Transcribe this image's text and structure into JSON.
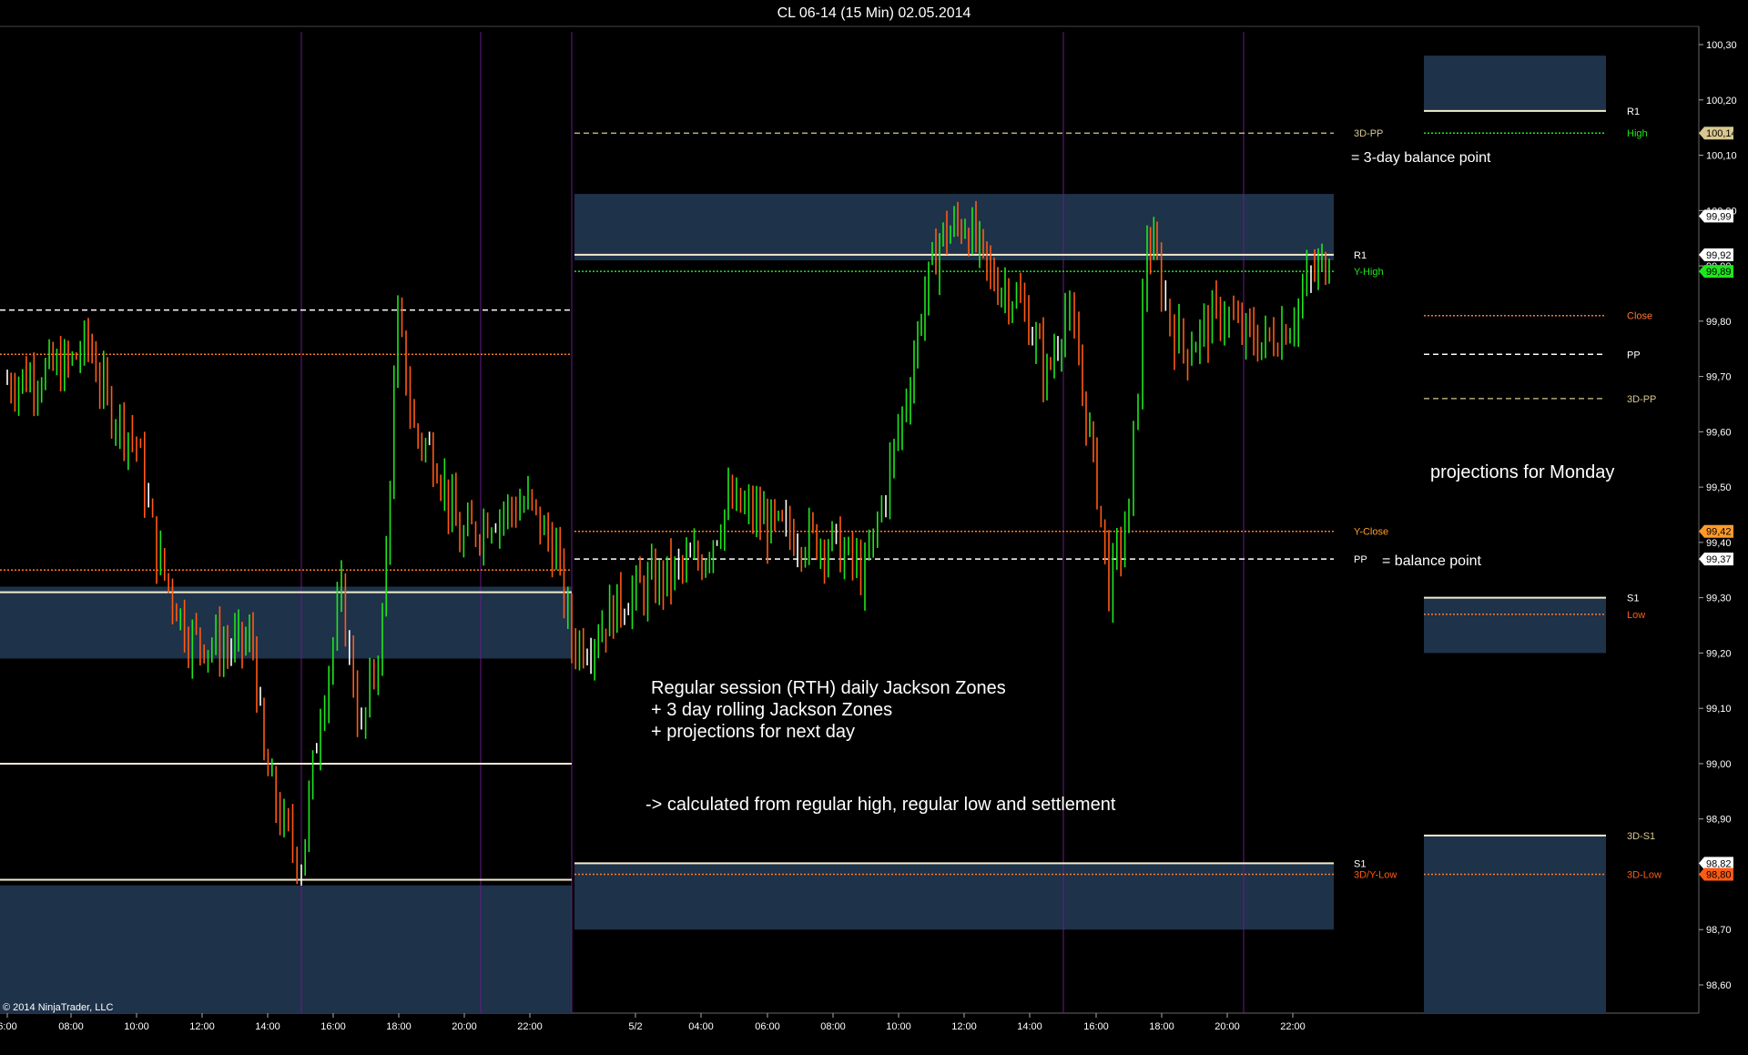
{
  "title": "CL 06-14 (15 Min)  02.05.2014",
  "copyright": "© 2014 NinjaTrader, LLC",
  "colors": {
    "background": "#000000",
    "zone_fill": "#1e3249",
    "bull": "#1ee61e",
    "bear": "#ff5a14",
    "doji": "#ffffff",
    "session_divider": "#7a1f9a",
    "pivot_line": "#f2eccf",
    "dotted_orange": "#ff7a2a",
    "dotted_green": "#1ee61e",
    "dashed_tan": "#d8c890",
    "dashed_white": "#ffffff"
  },
  "chart_data": {
    "type": "candlestick",
    "instrument": "CL 06-14",
    "interval": "15 Min",
    "date": "02.05.2014",
    "ylim": [
      98.53,
      100.33
    ],
    "yticks": [
      "100,30",
      "100,20",
      "100,10",
      "100,00",
      "99,90",
      "99,80",
      "99,70",
      "99,60",
      "99,50",
      "99,40",
      "99,30",
      "99,20",
      "99,10",
      "99,00",
      "98,90",
      "98,80",
      "98,70",
      "98,60"
    ],
    "xticks": [
      "6:00",
      "08:00",
      "10:00",
      "12:00",
      "14:00",
      "16:00",
      "18:00",
      "20:00",
      "22:00",
      "5/2",
      "04:00",
      "06:00",
      "08:00",
      "10:00",
      "12:00",
      "14:00",
      "16:00",
      "18:00",
      "20:00",
      "22:00"
    ],
    "price_badges": [
      {
        "value": 100.14,
        "text": "100,14",
        "color": "#d8c890"
      },
      {
        "value": 99.99,
        "text": "99,99",
        "color": "#ffffff"
      },
      {
        "value": 99.92,
        "text": "99,92",
        "color": "#ffffff"
      },
      {
        "value": 99.89,
        "text": "99,89",
        "color": "#1ee61e"
      },
      {
        "value": 99.42,
        "text": "99,42",
        "color": "#ff9a2a"
      },
      {
        "value": 99.37,
        "text": "99,37",
        "color": "#ffffff"
      },
      {
        "value": 98.82,
        "text": "98,82",
        "color": "#ffffff"
      },
      {
        "value": 98.8,
        "text": "98,80",
        "color": "#ff5a14"
      }
    ],
    "zones": [
      {
        "name": "day1-upper",
        "y1": 99.32,
        "y2": 99.19
      },
      {
        "name": "day1-lower",
        "y1": 98.78,
        "y2": 98.53
      },
      {
        "name": "day2-upper",
        "y1": 100.03,
        "y2": 99.91
      },
      {
        "name": "day2-lower",
        "y1": 98.82,
        "y2": 98.7
      },
      {
        "name": "proj-upper",
        "y1": 100.28,
        "y2": 100.18
      },
      {
        "name": "proj-s1",
        "y1": 99.3,
        "y2": 99.2
      },
      {
        "name": "proj-lower",
        "y1": 98.87,
        "y2": 98.53
      }
    ],
    "levels": [
      {
        "segment": "day1",
        "value": 99.82,
        "style": "dashed-white",
        "label": ""
      },
      {
        "segment": "day1",
        "value": 99.74,
        "style": "dotted-orange",
        "label": ""
      },
      {
        "segment": "day1",
        "value": 99.35,
        "style": "dotted-orange",
        "label": ""
      },
      {
        "segment": "day1",
        "value": 99.31,
        "style": "solid",
        "label": ""
      },
      {
        "segment": "day1",
        "value": 99.0,
        "style": "solid",
        "label": ""
      },
      {
        "segment": "day1",
        "value": 98.79,
        "style": "solid",
        "label": ""
      },
      {
        "segment": "day2",
        "value": 100.14,
        "style": "dashed-tan",
        "label": "3D-PP",
        "label_color": "#d8c890"
      },
      {
        "segment": "day2",
        "value": 99.92,
        "style": "solid",
        "label": "R1",
        "label_color": "#ffffff"
      },
      {
        "segment": "day2",
        "value": 99.89,
        "style": "dotted-green",
        "label": "Y-High",
        "label_color": "#1ee61e"
      },
      {
        "segment": "day2",
        "value": 99.42,
        "style": "dotted-orange",
        "label": "Y-Close",
        "label_color": "#ff9a2a"
      },
      {
        "segment": "day2",
        "value": 99.37,
        "style": "dashed-white",
        "label": "PP",
        "label_color": "#ffffff"
      },
      {
        "segment": "day2",
        "value": 98.82,
        "style": "solid",
        "label": "S1",
        "label_color": "#ffffff"
      },
      {
        "segment": "day2",
        "value": 98.8,
        "style": "dotted-orange",
        "label": "3D/Y-Low",
        "label_color": "#ff5a14"
      },
      {
        "segment": "proj",
        "value": 100.18,
        "style": "solid",
        "label": "R1",
        "label_color": "#ffffff"
      },
      {
        "segment": "proj",
        "value": 100.14,
        "style": "dotted-green",
        "label": "High",
        "label_color": "#1ee61e"
      },
      {
        "segment": "proj",
        "value": 99.81,
        "style": "dotted-orange",
        "label": "Close",
        "label_color": "#ff7a2a"
      },
      {
        "segment": "proj",
        "value": 99.74,
        "style": "dashed-white",
        "label": "PP",
        "label_color": "#ffffff"
      },
      {
        "segment": "proj",
        "value": 99.66,
        "style": "dashed-tan",
        "label": "3D-PP",
        "label_color": "#d8c890"
      },
      {
        "segment": "proj",
        "value": 99.3,
        "style": "solid",
        "label": "S1",
        "label_color": "#ffffff"
      },
      {
        "segment": "proj",
        "value": 99.27,
        "style": "dotted-orange",
        "label": "Low",
        "label_color": "#ff5a14"
      },
      {
        "segment": "proj",
        "value": 98.87,
        "style": "solid",
        "label": "3D-S1",
        "label_color": "#d8c890"
      },
      {
        "segment": "proj",
        "value": 98.8,
        "style": "dotted-orange",
        "label": "3D-Low",
        "label_color": "#ff5a14"
      }
    ],
    "close_path": [
      {
        "t": "6:00",
        "v": 99.69
      },
      {
        "t": "08:00",
        "v": 99.72
      },
      {
        "t": "08:30",
        "v": 99.76
      },
      {
        "t": "09:00",
        "v": 99.65
      },
      {
        "t": "10:00",
        "v": 99.58
      },
      {
        "t": "10:40",
        "v": 99.38
      },
      {
        "t": "11:30",
        "v": 99.23
      },
      {
        "t": "12:30",
        "v": 99.21
      },
      {
        "t": "13:30",
        "v": 99.22
      },
      {
        "t": "14:00",
        "v": 99.0
      },
      {
        "t": "14:40",
        "v": 98.88
      },
      {
        "t": "15:00",
        "v": 98.82
      },
      {
        "t": "15:30",
        "v": 99.1
      },
      {
        "t": "16:00",
        "v": 99.3
      },
      {
        "t": "16:40",
        "v": 99.05
      },
      {
        "t": "17:20",
        "v": 99.25
      },
      {
        "t": "17:50",
        "v": 99.8
      },
      {
        "t": "18:20",
        "v": 99.6
      },
      {
        "t": "19:00",
        "v": 99.55
      },
      {
        "t": "19:40",
        "v": 99.4
      },
      {
        "t": "20:30",
        "v": 99.45
      },
      {
        "t": "21:30",
        "v": 99.47
      },
      {
        "t": "22:30",
        "v": 99.38
      },
      {
        "t": "23:00",
        "v": 99.22
      },
      {
        "t": "5/2",
        "v": 99.22
      },
      {
        "t": "02:00",
        "v": 99.3
      },
      {
        "t": "04:00",
        "v": 99.37
      },
      {
        "t": "05:00",
        "v": 99.47
      },
      {
        "t": "06:00",
        "v": 99.45
      },
      {
        "t": "07:00",
        "v": 99.42
      },
      {
        "t": "08:00",
        "v": 99.4
      },
      {
        "t": "08:30",
        "v": 99.34
      },
      {
        "t": "09:00",
        "v": 99.5
      },
      {
        "t": "09:40",
        "v": 99.7
      },
      {
        "t": "10:00",
        "v": 99.82
      },
      {
        "t": "10:40",
        "v": 99.95
      },
      {
        "t": "11:20",
        "v": 99.98
      },
      {
        "t": "12:00",
        "v": 99.88
      },
      {
        "t": "12:40",
        "v": 99.85
      },
      {
        "t": "13:20",
        "v": 99.8
      },
      {
        "t": "13:50",
        "v": 99.7
      },
      {
        "t": "14:30",
        "v": 99.82
      },
      {
        "t": "15:10",
        "v": 99.72
      },
      {
        "t": "15:40",
        "v": 99.5
      },
      {
        "t": "16:10",
        "v": 99.32
      },
      {
        "t": "16:40",
        "v": 99.45
      },
      {
        "t": "17:00",
        "v": 99.7
      },
      {
        "t": "17:30",
        "v": 99.95
      },
      {
        "t": "18:00",
        "v": 99.9
      },
      {
        "t": "18:30",
        "v": 99.8
      },
      {
        "t": "19:00",
        "v": 99.75
      },
      {
        "t": "20:00",
        "v": 99.82
      },
      {
        "t": "20:40",
        "v": 99.78
      },
      {
        "t": "21:30",
        "v": 99.76
      },
      {
        "t": "22:00",
        "v": 99.8
      },
      {
        "t": "22:40",
        "v": 99.88
      },
      {
        "t": "23:00",
        "v": 99.92
      }
    ]
  },
  "annotations": {
    "three_day_balance": "= 3-day balance point",
    "balance_point": "= balance point",
    "projections_monday": "projections for Monday",
    "desc_line1": "Regular session (RTH) daily Jackson Zones",
    "desc_line2": "+ 3 day rolling Jackson Zones",
    "desc_line3": "+ projections for next day",
    "desc_line4": "-> calculated from regular high, regular low and settlement"
  }
}
